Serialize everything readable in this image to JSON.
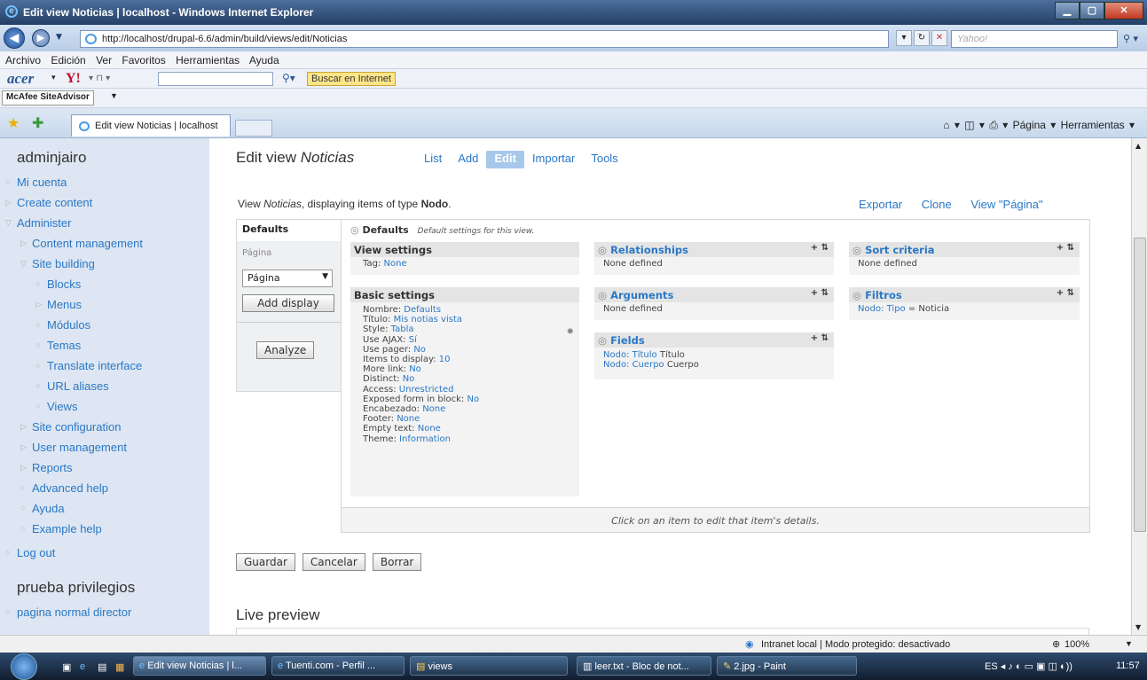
{
  "window": {
    "title": "Edit view Noticias | localhost - Windows Internet Explorer"
  },
  "browser": {
    "url": "http://localhost/drupal-6.6/admin/build/views/edit/Noticias",
    "search_placeholder": "Yahoo!",
    "menu": [
      "Archivo",
      "Edición",
      "Ver",
      "Favoritos",
      "Herramientas",
      "Ayuda"
    ],
    "acer_brand": "acer",
    "buscar_label": "Buscar en Internet",
    "mcafee_label": "McAfee SiteAdvisor",
    "tab_title": "Edit view Noticias | localhost",
    "tools_text": "Página ▾   Herramientas ▾"
  },
  "sidebar": {
    "user": "adminjairo",
    "items": [
      {
        "label": "Mi cuenta"
      },
      {
        "label": "Create content"
      },
      {
        "label": "Administer"
      },
      {
        "label": "Content management"
      },
      {
        "label": "Site building"
      },
      {
        "label": "Blocks"
      },
      {
        "label": "Menus"
      },
      {
        "label": "Módulos"
      },
      {
        "label": "Temas"
      },
      {
        "label": "Translate interface"
      },
      {
        "label": "URL aliases"
      },
      {
        "label": "Views"
      },
      {
        "label": "Site configuration"
      },
      {
        "label": "User management"
      },
      {
        "label": "Reports"
      },
      {
        "label": "Advanced help"
      },
      {
        "label": "Ayuda"
      },
      {
        "label": "Example help"
      },
      {
        "label": "Log out"
      }
    ],
    "block2_title": "prueba privilegios",
    "block2_item": "pagina normal director"
  },
  "main": {
    "title_prefix": "Edit view",
    "title_view": "Noticias",
    "tabs": [
      "List",
      "Add",
      "Edit",
      "Importar",
      "Tools"
    ],
    "desc_prefix": "View",
    "desc_view": "Noticias",
    "desc_middle": ", displaying items of type",
    "desc_type": "Nodo",
    "actions": [
      "Exportar",
      "Clone",
      "View \"Página\""
    ],
    "display_defaults": "Defaults",
    "display_pagina": "Página",
    "select_value": "Página",
    "add_display": "Add display",
    "analyze": "Analyze",
    "defaults_header": "Defaults",
    "defaults_desc": "Default settings for this view.",
    "view_settings": {
      "title": "View settings",
      "tag_label": "Tag:",
      "tag_value": "None"
    },
    "basic_settings": {
      "title": "Basic settings",
      "rows": [
        {
          "k": "Nombre: ",
          "v": "Defaults"
        },
        {
          "k": "Título: ",
          "v": "Mis notias vista"
        },
        {
          "k": "Style: ",
          "v": "Tabla"
        },
        {
          "k": "Use AJAX: ",
          "v": "Sí"
        },
        {
          "k": "Use pager: ",
          "v": "No"
        },
        {
          "k": "Items to display: ",
          "v": "10"
        },
        {
          "k": "More link: ",
          "v": "No"
        },
        {
          "k": "Distinct: ",
          "v": "No"
        },
        {
          "k": "Access: ",
          "v": "Unrestricted"
        },
        {
          "k": "Exposed form in block: ",
          "v": "No"
        },
        {
          "k": "Encabezado: ",
          "v": "None"
        },
        {
          "k": "Footer: ",
          "v": "None"
        },
        {
          "k": "Empty text: ",
          "v": "None"
        },
        {
          "k": "Theme: ",
          "v": "Information"
        }
      ]
    },
    "relationships": {
      "title": "Relationships",
      "body": "None defined"
    },
    "arguments": {
      "title": "Arguments",
      "body": "None defined"
    },
    "fields": {
      "title": "Fields",
      "rows": [
        {
          "link": "Nodo: Título",
          "text": " Título"
        },
        {
          "link": "Nodo: Cuerpo",
          "text": " Cuerpo"
        }
      ]
    },
    "sort": {
      "title": "Sort criteria",
      "body": "None defined"
    },
    "filters": {
      "title": "Filtros",
      "link": "Nodo: Tipo",
      "text": " = Noticia"
    },
    "footer_hint": "Click on an item to edit that item's details.",
    "buttons": [
      "Guardar",
      "Cancelar",
      "Borrar"
    ],
    "live_preview": "Live preview"
  },
  "status": {
    "zone": "Intranet local | Modo protegido: desactivado",
    "zoom": "100%"
  },
  "taskbar": {
    "items": [
      "Edit view Noticias | l...",
      "Tuenti.com - Perfil ...",
      "views",
      "leer.txt - Bloc de not...",
      "2.jpg - Paint"
    ],
    "lang": "ES",
    "clock": "11:57"
  }
}
